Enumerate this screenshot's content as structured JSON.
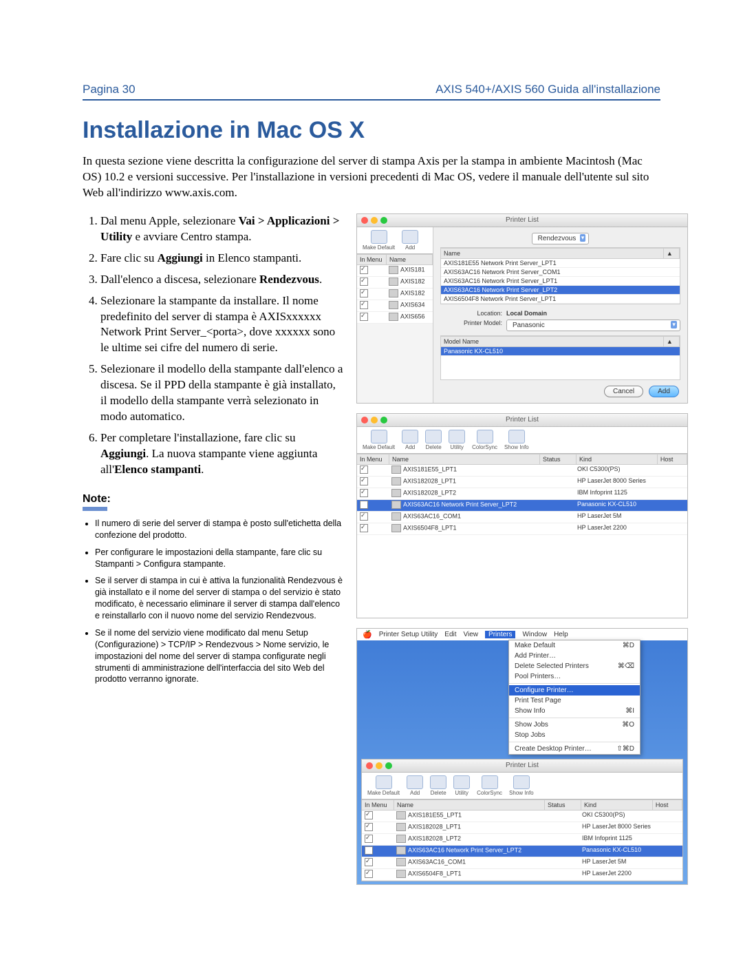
{
  "header": {
    "left": "Pagina 30",
    "right": "AXIS 540+/AXIS 560 Guida all'installazione"
  },
  "title": "Installazione in Mac OS X",
  "intro": "In questa sezione viene descritta la configurazione del server di stampa Axis per la stampa in ambiente Macintosh (Mac OS) 10.2 e versioni successive. Per l'installazione in versioni precedenti di Mac OS, vedere il manuale dell'utente sul sito Web all'indirizzo www.axis.com.",
  "steps": [
    {
      "pre": "Dal menu Apple, selezionare ",
      "bold": "Vai > Applicazioni > Utility",
      "post": " e avviare Centro stampa."
    },
    {
      "pre": "Fare clic su ",
      "bold": "Aggiungi",
      "post": " in Elenco stampanti."
    },
    {
      "pre": "Dall'elenco a discesa, selezionare ",
      "bold": "Rendezvous",
      "post": "."
    },
    {
      "pre": "Selezionare la stampante da installare. Il nome predefinito del server di stampa è AXISxxxxxx Network Print Server_<porta>, dove xxxxxx sono le ultime sei cifre del numero di serie.",
      "bold": "",
      "post": ""
    },
    {
      "pre": "Selezionare il modello della stampante dall'elenco a discesa. Se il PPD della stampante è già installato, il modello della stampante verrà selezionato in modo automatico.",
      "bold": "",
      "post": ""
    },
    {
      "pre": "Per completare l'installazione, fare clic su ",
      "bold": "Aggiungi",
      "post": ". La nuova stampante viene aggiunta all'",
      "bold2": "Elenco stampanti",
      "post2": "."
    }
  ],
  "note_label": "Note:",
  "notes": [
    "Il numero di serie del server di stampa è posto sull'etichetta della confezione del prodotto.",
    "Per configurare le impostazioni della stampante, fare clic su Stampanti > Configura stampante.",
    "Se il server di stampa in cui è attiva la funzionalità Rendezvous è già installato e il nome del server di stampa o del servizio è stato modificato, è necessario eliminare il server di stampa dall'elenco e reinstallarlo con il nuovo nome del servizio Rendezvous.",
    "Se il nome del servizio viene modificato dal menu Setup (Configurazione) > TCP/IP > Rendezvous > Nome servizio, le impostazioni del nome del server di stampa configurate negli strumenti di amministrazione dell'interfaccia del sito Web del prodotto verranno ignorate."
  ],
  "shot1": {
    "title": "Printer List",
    "tb": [
      "Make Default",
      "Add"
    ],
    "left_hdr": [
      "In Menu",
      "Name"
    ],
    "left_rows": [
      "AXIS181",
      "AXIS182",
      "AXIS182",
      "AXIS634",
      "AXIS656"
    ],
    "sel": "Rendezvous",
    "name_hdr": "Name",
    "right_rows": [
      "AXIS181E55 Network Print Server_LPT1",
      "AXIS63AC16 Network Print Server_COM1",
      "AXIS63AC16 Network Print Server_LPT1",
      "AXIS63AC16 Network Print Server_LPT2",
      "AXIS6504F8 Network Print Server_LPT1"
    ],
    "sel_row": 3,
    "loc_lbl": "Location:",
    "loc_val": "Local Domain",
    "model_lbl": "Printer Model:",
    "model_val": "Panasonic",
    "model_hdr": "Model Name",
    "model_row": "Panasonic KX-CL510",
    "cancel": "Cancel",
    "add": "Add"
  },
  "shot2": {
    "title": "Printer List",
    "tb": [
      "Make Default",
      "Add",
      "Delete",
      "Utility",
      "ColorSync",
      "Show Info"
    ],
    "hdr": [
      "In Menu",
      "Name",
      "Status",
      "Kind",
      "Host"
    ],
    "rows": [
      {
        "n": "AXIS181E55_LPT1",
        "k": "OKI C5300(PS)"
      },
      {
        "n": "AXIS182028_LPT1",
        "k": "HP LaserJet 8000 Series"
      },
      {
        "n": "AXIS182028_LPT2",
        "k": "IBM Infoprint 1125"
      },
      {
        "n": "AXIS63AC16 Network Print Server_LPT2",
        "k": "Panasonic KX-CL510",
        "sel": true
      },
      {
        "n": "AXIS63AC16_COM1",
        "k": "HP LaserJet 5M"
      },
      {
        "n": "AXIS6504F8_LPT1",
        "k": "HP LaserJet 2200"
      }
    ]
  },
  "shot3": {
    "menu": [
      "Printer Setup Utility",
      "Edit",
      "View",
      "Printers",
      "Window",
      "Help"
    ],
    "menu_sel": 3,
    "items": [
      {
        "t": "Make Default",
        "s": "⌘D"
      },
      {
        "t": "Add Printer…",
        "s": ""
      },
      {
        "t": "Delete Selected Printers",
        "s": "⌘⌫"
      },
      {
        "t": "Pool Printers…",
        "s": ""
      },
      {
        "t": "Configure Printer…",
        "s": "",
        "sel": true
      },
      {
        "t": "Print Test Page",
        "s": ""
      },
      {
        "t": "Show Info",
        "s": "⌘I"
      },
      {
        "t": "Show Jobs",
        "s": "⌘O"
      },
      {
        "t": "Stop Jobs",
        "s": ""
      },
      {
        "t": "Create Desktop Printer…",
        "s": "⇧⌘D"
      }
    ],
    "title": "Printer List",
    "tb": [
      "Make Default",
      "Add",
      "Delete",
      "Utility",
      "ColorSync",
      "Show Info"
    ],
    "hdr": [
      "In Menu",
      "Name",
      "Status",
      "Kind",
      "Host"
    ],
    "rows": [
      {
        "n": "AXIS181E55_LPT1",
        "k": "OKI C5300(PS)"
      },
      {
        "n": "AXIS182028_LPT1",
        "k": "HP LaserJet 8000 Series"
      },
      {
        "n": "AXIS182028_LPT2",
        "k": "IBM Infoprint 1125"
      },
      {
        "n": "AXIS63AC16 Network Print Server_LPT2",
        "k": "Panasonic KX-CL510",
        "sel": true
      },
      {
        "n": "AXIS63AC16_COM1",
        "k": "HP LaserJet 5M"
      },
      {
        "n": "AXIS6504F8_LPT1",
        "k": "HP LaserJet 2200"
      }
    ]
  }
}
